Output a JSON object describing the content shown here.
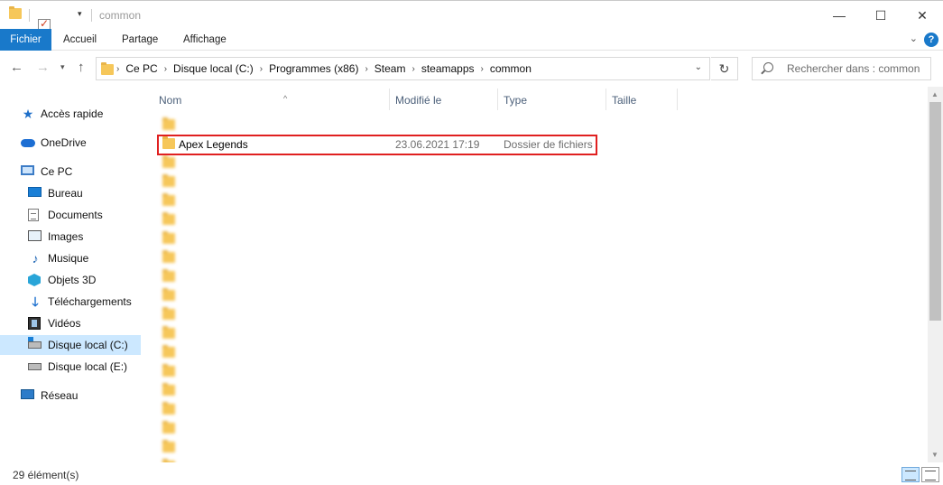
{
  "window": {
    "title": "common",
    "controls": {
      "minimize": "—",
      "maximize": "☐",
      "close": "✕"
    }
  },
  "ribbon": {
    "tabs": [
      "Fichier",
      "Accueil",
      "Partage",
      "Affichage"
    ],
    "help": "?"
  },
  "address": {
    "crumbs": [
      "Ce PC",
      "Disque local (C:)",
      "Programmes (x86)",
      "Steam",
      "steamapps",
      "common"
    ],
    "search_placeholder": "Rechercher dans : common"
  },
  "sidebar": {
    "items": [
      {
        "label": "Accès rapide",
        "icon": "star-icon"
      },
      {
        "label": "OneDrive",
        "icon": "cloud-icon"
      },
      {
        "label": "Ce PC",
        "icon": "pc-icon"
      },
      {
        "label": "Bureau",
        "icon": "desktop-icon"
      },
      {
        "label": "Documents",
        "icon": "document-icon"
      },
      {
        "label": "Images",
        "icon": "image-icon"
      },
      {
        "label": "Musique",
        "icon": "music-icon"
      },
      {
        "label": "Objets 3D",
        "icon": "cube-icon"
      },
      {
        "label": "Téléchargements",
        "icon": "download-icon"
      },
      {
        "label": "Vidéos",
        "icon": "video-icon"
      },
      {
        "label": "Disque local (C:)",
        "icon": "drive-icon",
        "selected": true
      },
      {
        "label": "Disque local (E:)",
        "icon": "drive-icon"
      },
      {
        "label": "Réseau",
        "icon": "network-icon"
      }
    ]
  },
  "columns": {
    "name": "Nom",
    "modified": "Modifié le",
    "type": "Type",
    "size": "Taille"
  },
  "files": [
    {
      "name": "Apex Legends",
      "modified": "23.06.2021 17:19",
      "type": "Dossier de fichiers",
      "highlighted": true
    }
  ],
  "status": {
    "item_count": "29 élément(s)"
  },
  "colors": {
    "accent": "#1979ca",
    "selection": "#cce8ff",
    "highlight_border": "#e02020",
    "folder": "#f6c75a"
  }
}
